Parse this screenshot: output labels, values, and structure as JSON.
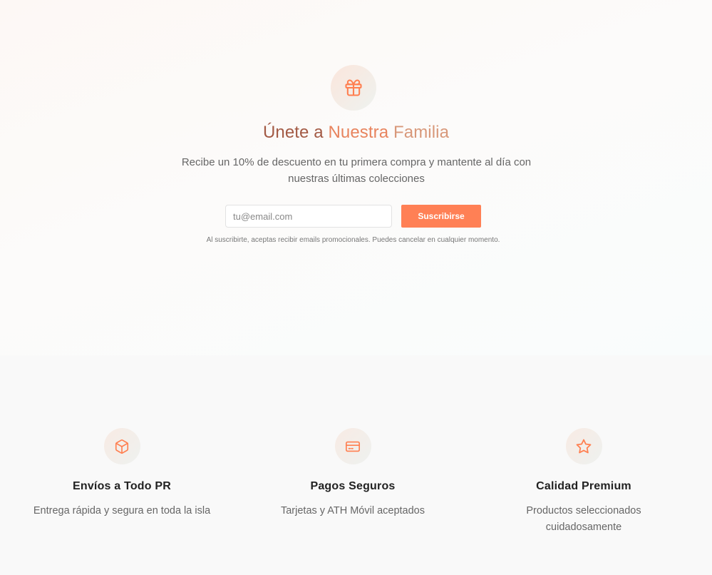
{
  "newsletter": {
    "icon": "gift-icon",
    "title_part1": "Únete a ",
    "title_part2": "Nuestra ",
    "title_part3": "Familia",
    "description": "Recibe un 10% de descuento en tu primera compra y mantente al día con nuestras últimas colecciones",
    "email_placeholder": "tu@email.com",
    "email_value": "",
    "subscribe_label": "Suscribirse",
    "disclaimer": "Al suscribirte, aceptas recibir emails promocionales. Puedes cancelar en cualquier momento."
  },
  "features": [
    {
      "icon": "box-icon",
      "title": "Envíos a Todo PR",
      "description": "Entrega rápida y segura en toda la isla"
    },
    {
      "icon": "credit-card-icon",
      "title": "Pagos Seguros",
      "description": "Tarjetas y ATH Móvil aceptados"
    },
    {
      "icon": "star-icon",
      "title": "Calidad Premium",
      "description": "Productos seleccionados cuidadosamente"
    }
  ],
  "colors": {
    "accent": "#ff8055",
    "title": "#a35a45",
    "text": "#666666"
  }
}
